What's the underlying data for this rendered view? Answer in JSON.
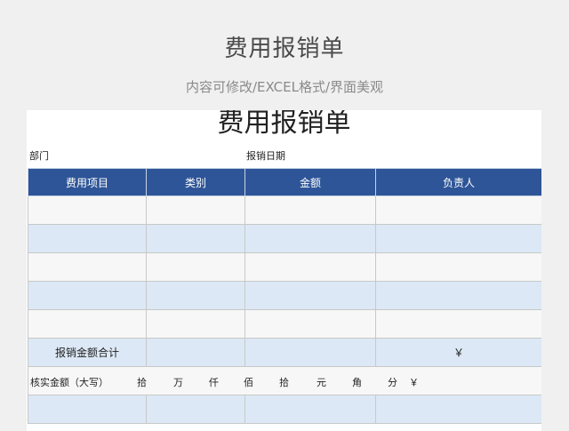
{
  "banner": {
    "title": "费用报销单",
    "subtitle": "内容可修改/EXCEL格式/界面美观"
  },
  "sheet": {
    "title": "费用报销单",
    "department_label": "部门",
    "date_label": "报销日期",
    "headers": [
      "费用项目",
      "类别",
      "金额",
      "负责人"
    ],
    "total_label": "报销金额合计",
    "total_currency": "￥",
    "verify_label": "核实金额（大写）",
    "units": [
      "拾",
      "万",
      "仟",
      "佰",
      "拾",
      "元",
      "角",
      "分"
    ],
    "verify_currency": "￥"
  },
  "colors": {
    "header_bg": "#2e5597",
    "band_blue": "#dce8f5",
    "page_bg": "#f0f0f0"
  }
}
